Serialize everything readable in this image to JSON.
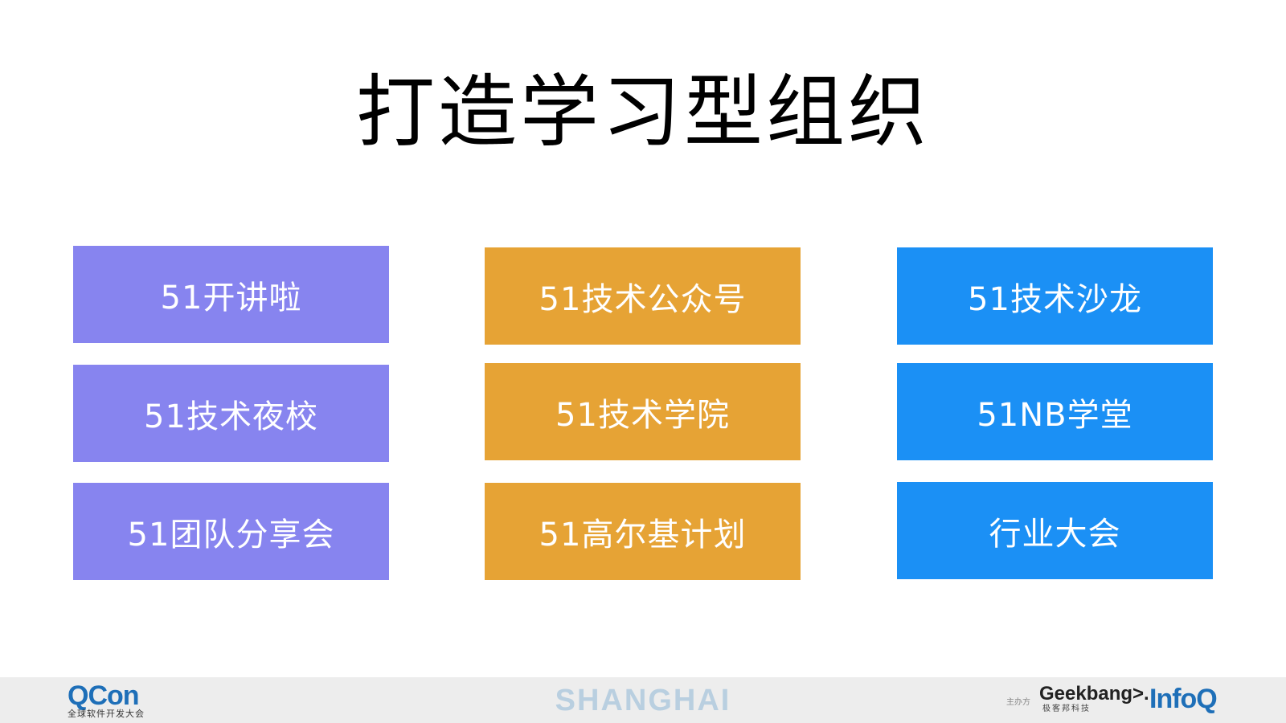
{
  "slide": {
    "title": "打造学习型组织"
  },
  "colors": {
    "purple": "#8784ef",
    "orange": "#e6a335",
    "blue": "#1b90f5",
    "footer_bg": "#ededed"
  },
  "columns": [
    {
      "items": [
        "51开讲啦",
        "51技术夜校",
        "51团队分享会"
      ]
    },
    {
      "items": [
        "51技术公众号",
        "51技术学院",
        "51高尔基计划"
      ]
    },
    {
      "items": [
        "51技术沙龙",
        "51NB学堂",
        "行业大会"
      ]
    }
  ],
  "footer": {
    "qcon_logo": "QCon",
    "qcon_subtitle": "全球软件开发大会",
    "city": "SHANGHAI",
    "sponsor_label": "主办方",
    "geekbang_logo": "Geekbang>.",
    "geekbang_subtitle": "极客邦科技",
    "infoq_logo": "InfoQ"
  }
}
